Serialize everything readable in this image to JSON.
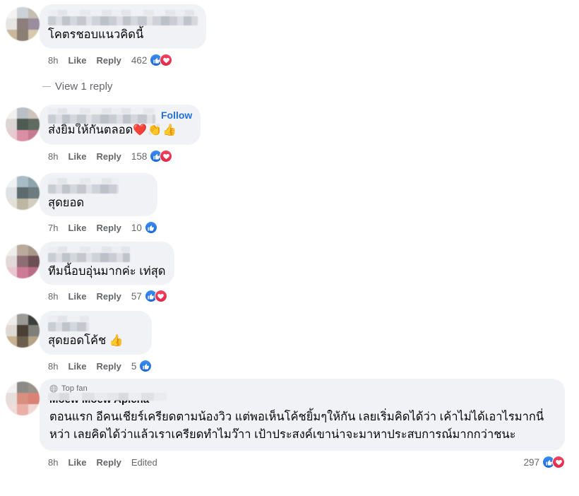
{
  "app": {
    "name": "facebook-comments",
    "accent_blue": "#216FDB",
    "bubble_bg": "#F0F2F5",
    "text_primary": "#050505",
    "text_secondary": "#65676B",
    "reaction_like_color": "#1B66D6",
    "reaction_love_color": "#E0294A"
  },
  "labels": {
    "like": "Like",
    "reply": "Reply",
    "edited": "Edited",
    "follow": "Follow",
    "top_fan": "Top fan",
    "view_replies": "View 1 reply"
  },
  "comments": [
    {
      "id": "c1",
      "author_redacted": true,
      "author_name": "",
      "text": "โคตรชอบแนวคิดนี้",
      "time": "8h",
      "like": "Like",
      "reply": "Reply",
      "reaction_count": "462",
      "reactions": [
        "like-icon",
        "love-icon"
      ],
      "has_follow": false,
      "has_replies": true,
      "replies_label": "View 1 reply"
    },
    {
      "id": "c2",
      "author_redacted": true,
      "author_name": "",
      "text": "ส่งยิ้มให้กันตลอด",
      "emojis": "❤️👏👍",
      "time": "8h",
      "like": "Like",
      "reply": "Reply",
      "reaction_count": "158",
      "reactions": [
        "like-icon",
        "love-icon"
      ],
      "has_follow": true,
      "follow_label": "Follow"
    },
    {
      "id": "c3",
      "author_redacted": true,
      "author_name": "",
      "text": "สุดยอด",
      "time": "7h",
      "like": "Like",
      "reply": "Reply",
      "reaction_count": "10",
      "reactions": [
        "like-icon"
      ],
      "has_follow": false
    },
    {
      "id": "c4",
      "author_redacted": true,
      "author_name": "",
      "text": "ทีมนี้อบอุ่นมากค่ะ เท่สุด",
      "time": "8h",
      "like": "Like",
      "reply": "Reply",
      "reaction_count": "57",
      "reactions": [
        "like-icon",
        "love-icon"
      ],
      "has_follow": false
    },
    {
      "id": "c5",
      "author_redacted": true,
      "author_name": "",
      "text": "สุดยอดโค้ช",
      "emojis": "👍",
      "time": "8h",
      "like": "Like",
      "reply": "Reply",
      "reaction_count": "5",
      "reactions": [
        "like-icon"
      ],
      "has_follow": false
    },
    {
      "id": "c6",
      "author_redacted": false,
      "author_name": "Moew Moew Apicha",
      "badge": "Top fan",
      "text": "ตอนแรก อีคนเชียร์เครียดตามน้องวิว แต่พอเห็นโค้ชยิ้มๆให้กัน เลยเริ่มคิดได้ว่า เค้าไม่ได้เอาไรมากนี่หว่า เลยคิดได้ว่าแล้วเราเครียดทำไมว๊าา เป้าประสงค์เขาน่าจะมาหาประสบการณ์มากกว่าชนะ",
      "time": "8h",
      "like": "Like",
      "reply": "Reply",
      "edited": "Edited",
      "reaction_count": "297",
      "reactions": [
        "like-icon",
        "love-icon"
      ],
      "has_follow": false
    }
  ]
}
